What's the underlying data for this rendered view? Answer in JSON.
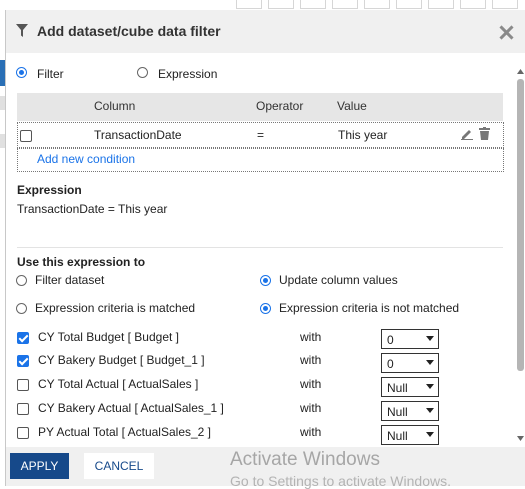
{
  "dialog": {
    "title": "Add dataset/cube data filter",
    "title_icon": "filter-icon",
    "close_icon": "close-icon"
  },
  "mode": {
    "filter_label": "Filter",
    "expression_label": "Expression",
    "selected": "filter"
  },
  "grid": {
    "columns": [
      "Column",
      "Operator",
      "Value"
    ],
    "rows": [
      {
        "column": "TransactionDate",
        "operator": "=",
        "value": "This year",
        "checked": false
      }
    ],
    "add_label": "Add new condition"
  },
  "expression": {
    "heading": "Expression",
    "text": "TransactionDate = This year"
  },
  "use": {
    "heading": "Use this expression to",
    "options_left": [
      "Filter dataset",
      "Expression criteria is matched"
    ],
    "options_right": [
      "Update column values",
      "Expression criteria is not matched"
    ],
    "selected_left": null,
    "selected_right": [
      0,
      1
    ]
  },
  "columns_update": [
    {
      "label": "CY Total Budget [ Budget ]",
      "with": "with",
      "value": "0",
      "checked": true
    },
    {
      "label": "CY Bakery Budget [ Budget_1 ]",
      "with": "with",
      "value": "0",
      "checked": true
    },
    {
      "label": "CY Total Actual [ ActualSales ]",
      "with": "with",
      "value": "Null",
      "checked": false
    },
    {
      "label": "CY Bakery Actual [ ActualSales_1 ]",
      "with": "with",
      "value": "Null",
      "checked": false
    },
    {
      "label": "PY Actual Total [ ActualSales_2 ]",
      "with": "with",
      "value": "Null",
      "checked": false
    }
  ],
  "footer": {
    "apply_label": "APPLY",
    "cancel_label": "CANCEL"
  },
  "watermark": {
    "line1": "Activate Windows",
    "line2": "Go to Settings to activate Windows."
  },
  "colors": {
    "accent": "#1a73e8",
    "button": "#16498a",
    "header_bg": "#f0f0f0"
  }
}
